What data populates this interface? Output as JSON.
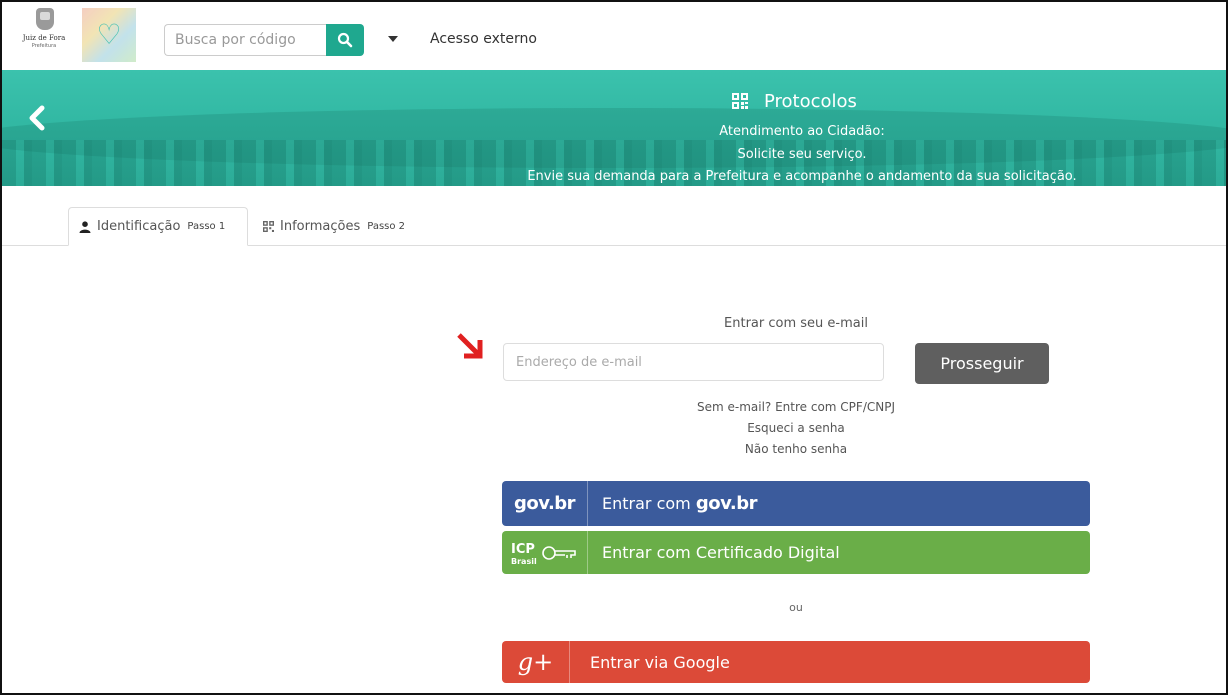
{
  "header": {
    "logo_city_name": "Juiz de Fora",
    "logo_city_sub": "Prefeitura",
    "search_placeholder": "Busca por código",
    "acesso_label": "Acesso externo"
  },
  "banner": {
    "title": "Protocolos",
    "line1": "Atendimento ao Cidadão:",
    "line2": "Solicite seu serviço.",
    "line3": "Envie sua demanda para a Prefeitura e acompanhe o andamento da sua solicitação."
  },
  "tabs": [
    {
      "label": "Identificação",
      "step": "Passo 1",
      "active": true
    },
    {
      "label": "Informações",
      "step": "Passo 2",
      "active": false
    }
  ],
  "login": {
    "title": "Entrar com seu e-mail",
    "email_placeholder": "Endereço de e-mail",
    "submit_label": "Prosseguir",
    "no_email_link": "Sem e-mail? Entre com CPF/CNPJ",
    "forgot_link": "Esqueci a senha",
    "no_password_link": "Não tenho senha",
    "gov_logo": "gov.br",
    "gov_label_prefix": "Entrar com",
    "gov_label_brand": "gov.br",
    "icp_label": "Entrar com Certificado Digital",
    "icp_logo_top": "ICP",
    "icp_logo_bottom": "Brasil",
    "or_label": "ou",
    "google_icon": "g+",
    "google_label": "Entrar via Google"
  },
  "colors": {
    "accent": "#1fa88f",
    "banner": "#33b9a4",
    "gov_blue": "#3b5b9c",
    "icp_green": "#6aae48",
    "google_red": "#dc4a38",
    "prosseguir_gray": "#5f5f5f",
    "annotation_arrow": "#e02020"
  },
  "icons": {
    "search": "magnifier-icon",
    "back": "chevron-left-icon",
    "protocolos": "qrcode-icon",
    "user": "user-icon",
    "info": "qrcode-icon",
    "annotation": "arrow-down-right-icon"
  }
}
